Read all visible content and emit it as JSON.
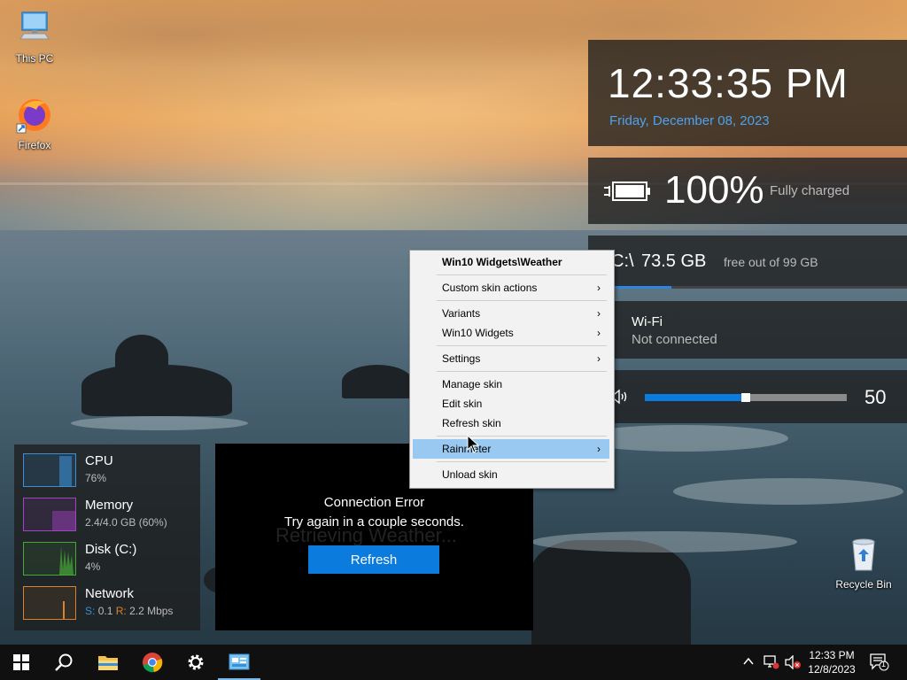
{
  "desktop": {
    "icons": [
      {
        "label": "This PC"
      },
      {
        "label": "Firefox"
      },
      {
        "label": "Recycle Bin"
      }
    ]
  },
  "clock_widget": {
    "time": "12:33:35 PM",
    "date": "Friday, December 08, 2023"
  },
  "battery_widget": {
    "percent": "100%",
    "status": "Fully charged"
  },
  "disk_widget": {
    "drive": "C:\\",
    "free": "73.5 GB",
    "total": "free out of 99 GB",
    "used_fraction": 0.26
  },
  "wifi_widget": {
    "title": "Wi-Fi",
    "status": "Not connected"
  },
  "volume_widget": {
    "value": "50",
    "level_fraction": 0.5
  },
  "system_monitor": {
    "rows": [
      {
        "label": "CPU",
        "value": "76%",
        "color": "#3a8fd6"
      },
      {
        "label": "Memory",
        "value": "2.4/4.0 GB (60%)",
        "color": "#a640c8"
      },
      {
        "label": "Disk (C:)",
        "value": "4%",
        "color": "#46a836"
      },
      {
        "label": "Network",
        "value_s_label": "S:",
        "value_s": "0.1",
        "value_r_label": "R:",
        "value_r": "2.2 Mbps",
        "color": "#d9822b"
      }
    ]
  },
  "weather_widget": {
    "ghost_text": "Retrieving Weather...",
    "error_title": "Connection Error",
    "error_message": "Try again in a couple seconds.",
    "refresh_label": "Refresh"
  },
  "context_menu": {
    "title": "Win10 Widgets\\Weather",
    "items": [
      {
        "label": "Custom skin actions",
        "submenu": true
      },
      {
        "label": "Variants",
        "submenu": true
      },
      {
        "label": "Win10 Widgets",
        "submenu": true
      },
      {
        "label": "Settings",
        "submenu": true
      },
      {
        "label": "Manage skin",
        "submenu": false
      },
      {
        "label": "Edit skin",
        "submenu": false
      },
      {
        "label": "Refresh skin",
        "submenu": false
      },
      {
        "label": "Rainmeter",
        "submenu": true
      },
      {
        "label": "Unload skin",
        "submenu": false
      }
    ],
    "arrow_glyph": "›"
  },
  "taskbar": {
    "time": "12:33 PM",
    "date": "12/8/2023",
    "notification_count": "1"
  },
  "colors": {
    "accent_blue": "#0b7bde",
    "date_blue": "#4ba3f2",
    "menu_highlight": "#99c9f0"
  }
}
